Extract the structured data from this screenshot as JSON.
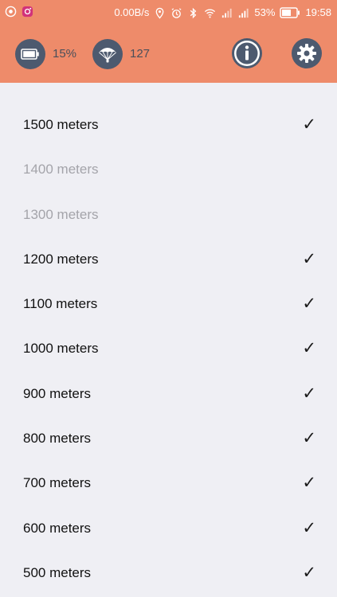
{
  "status_bar": {
    "network_speed": "0.00B/s",
    "battery_percent": "53%",
    "time": "19:58"
  },
  "toolbar": {
    "battery_level": "15%",
    "jump_count": "127"
  },
  "altitudes": [
    {
      "label": "1500 meters",
      "enabled": true,
      "checked": true,
      "check": "✓"
    },
    {
      "label": "1400 meters",
      "enabled": false,
      "checked": false,
      "check": ""
    },
    {
      "label": "1300 meters",
      "enabled": false,
      "checked": false,
      "check": ""
    },
    {
      "label": "1200 meters",
      "enabled": true,
      "checked": true,
      "check": "✓"
    },
    {
      "label": "1100 meters",
      "enabled": true,
      "checked": true,
      "check": "✓"
    },
    {
      "label": "1000 meters",
      "enabled": true,
      "checked": true,
      "check": "✓"
    },
    {
      "label": "900 meters",
      "enabled": true,
      "checked": true,
      "check": "✓"
    },
    {
      "label": "800 meters",
      "enabled": true,
      "checked": true,
      "check": "✓"
    },
    {
      "label": "700 meters",
      "enabled": true,
      "checked": true,
      "check": "✓"
    },
    {
      "label": "600 meters",
      "enabled": true,
      "checked": true,
      "check": "✓"
    },
    {
      "label": "500 meters",
      "enabled": true,
      "checked": true,
      "check": "✓"
    }
  ]
}
